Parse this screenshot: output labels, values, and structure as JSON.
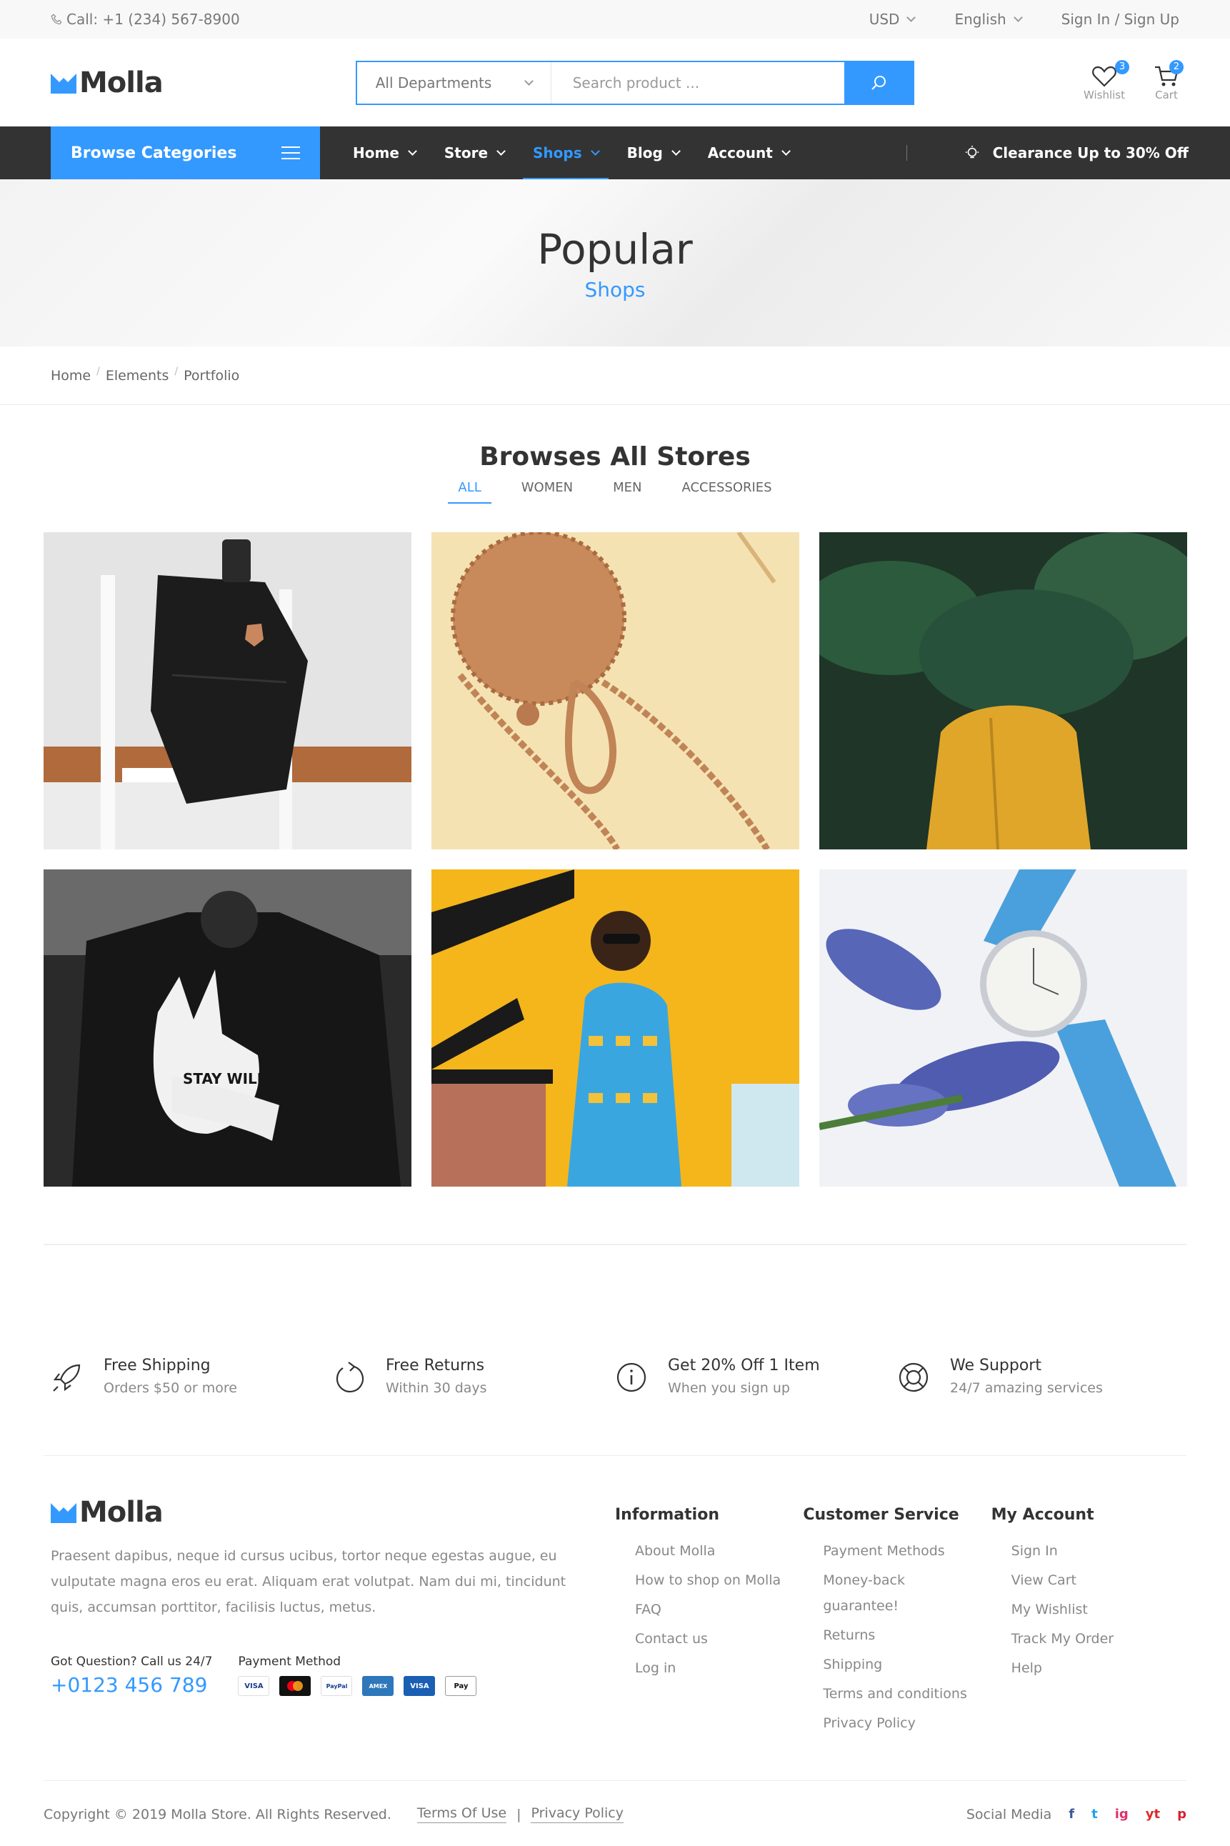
{
  "topbar": {
    "call": "Call: +1 (234) 567-8900",
    "currency": "USD",
    "language": "English",
    "auth": "Sign In / Sign Up"
  },
  "header": {
    "logo": "Molla",
    "dept_select": "All Departments",
    "search_placeholder": "Search product ...",
    "wishlist_label": "Wishlist",
    "wishlist_count": "3",
    "cart_label": "Cart",
    "cart_count": "2"
  },
  "nav": {
    "browse": "Browse Categories",
    "items": [
      "Home",
      "Store",
      "Shops",
      "Blog",
      "Account"
    ],
    "active": "Shops",
    "promo": "Clearance Up to 30% Off"
  },
  "hero": {
    "title": "Popular",
    "subtitle": "Shops"
  },
  "breadcrumb": [
    "Home",
    "Elements",
    "Portfolio"
  ],
  "stores": {
    "title": "Browses All Stores",
    "filters": [
      "ALL",
      "WOMEN",
      "MEN",
      "ACCESSORIES"
    ],
    "active_filter": "ALL",
    "tile_labels": [
      "STAY WILD"
    ]
  },
  "features": [
    {
      "icon": "rocket-icon",
      "title": "Free Shipping",
      "desc": "Orders $50 or more"
    },
    {
      "icon": "return-icon",
      "title": "Free Returns",
      "desc": "Within 30 days"
    },
    {
      "icon": "info-icon",
      "title": "Get 20% Off 1 Item",
      "desc": "When you sign up"
    },
    {
      "icon": "lifebuoy-icon",
      "title": "We Support",
      "desc": "24/7 amazing services"
    }
  ],
  "footer": {
    "logo": "Molla",
    "about": "Praesent dapibus, neque id cursus ucibus, tortor neque egestas augue, eu vulputate magna eros eu erat. Aliquam erat volutpat. Nam dui mi, tincidunt quis, accumsan porttitor, facilisis luctus, metus.",
    "question_label": "Got Question? Call us 24/7",
    "phone": "+0123 456 789",
    "payment_label": "Payment Method",
    "payments": [
      "VISA",
      "MC",
      "PayPal",
      "AMEX",
      "VISA",
      "Pay"
    ],
    "columns": [
      {
        "title": "Information",
        "links": [
          "About Molla",
          "How to shop on Molla",
          "FAQ",
          "Contact us",
          "Log in"
        ]
      },
      {
        "title": "Customer Service",
        "links": [
          "Payment Methods",
          "Money-back guarantee!",
          "Returns",
          "Shipping",
          "Terms and conditions",
          "Privacy Policy"
        ]
      },
      {
        "title": "My Account",
        "links": [
          "Sign In",
          "View Cart",
          "My Wishlist",
          "Track My Order",
          "Help"
        ]
      }
    ],
    "copyright": "Copyright © 2019 Molla Store. All Rights Reserved.",
    "terms": "Terms Of Use",
    "privacy": "Privacy Policy",
    "social_label": "Social Media",
    "social": [
      "f",
      "t",
      "ig",
      "yt",
      "p"
    ]
  },
  "colors": {
    "accent": "#3399ff",
    "nav_bg": "#333333"
  }
}
